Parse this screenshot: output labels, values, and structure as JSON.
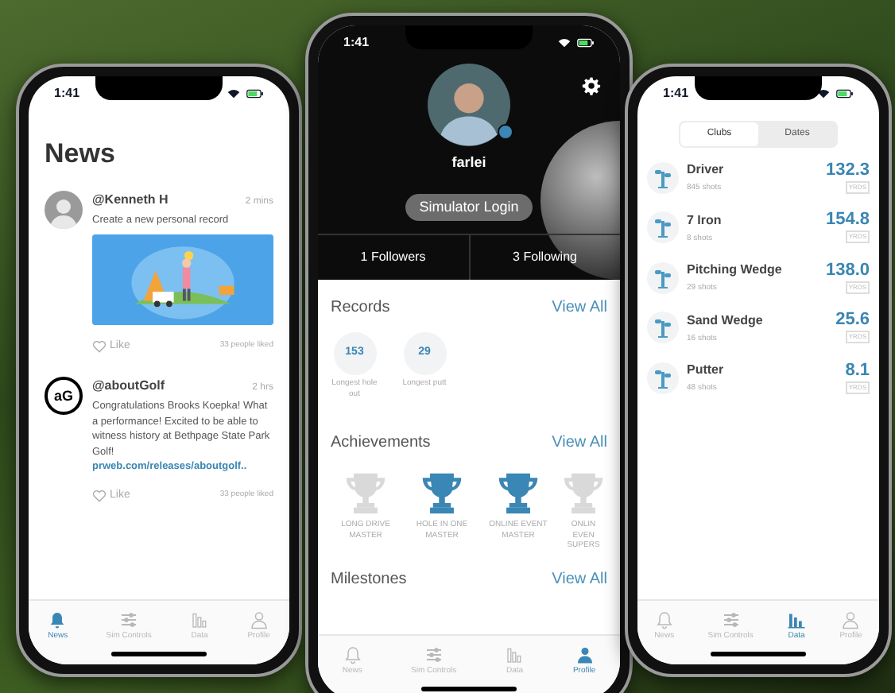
{
  "news_phone": {
    "time": "1:41",
    "title": "News",
    "posts": [
      {
        "kind": "photo",
        "author": "@Kenneth H",
        "age": "2 mins",
        "text": "Create a new personal record",
        "image": true,
        "like": "Like",
        "likes": "33 people liked"
      },
      {
        "kind": "logo",
        "logo": "aG",
        "author": "@aboutGolf",
        "age": "2 hrs",
        "text": "Congratulations Brooks Koepka! What a performance! Excited to be able to witness history at Bethpage State Park Golf!",
        "link": "prweb.com/releases/aboutgolf..",
        "like": "Like",
        "likes": "33 people liked"
      }
    ],
    "tabs": [
      {
        "label": "News",
        "selected": true
      },
      {
        "label": "Sim Controls",
        "selected": false
      },
      {
        "label": "Data",
        "selected": false
      },
      {
        "label": "Profile",
        "selected": false
      }
    ]
  },
  "profile_phone": {
    "time": "1:41",
    "username": "farlei",
    "login_button": "Simulator Login",
    "followers": "1 Followers",
    "following": "3 Following",
    "records": {
      "title": "Records",
      "action": "View All",
      "items": [
        {
          "value": "153",
          "label": "Longest hole out"
        },
        {
          "value": "29",
          "label": "Longest putt"
        }
      ]
    },
    "achievements": {
      "title": "Achievements",
      "action": "View All",
      "items": [
        {
          "label": "LONG DRIVE MASTER",
          "earned": false
        },
        {
          "label": "HOLE IN ONE MASTER",
          "earned": true
        },
        {
          "label": "ONLINE EVENT MASTER",
          "earned": true
        },
        {
          "label": "ONLIN EVEN SUPERS",
          "earned": false
        }
      ]
    },
    "milestones": {
      "title": "Milestones",
      "action": "View All"
    },
    "tabs": [
      {
        "label": "News",
        "selected": false
      },
      {
        "label": "Sim Controls",
        "selected": false
      },
      {
        "label": "Data",
        "selected": false
      },
      {
        "label": "Profile",
        "selected": true
      }
    ]
  },
  "data_phone": {
    "time": "1:41",
    "segments": [
      {
        "label": "Clubs",
        "selected": true
      },
      {
        "label": "Dates",
        "selected": false
      }
    ],
    "clubs": [
      {
        "name": "Driver",
        "shots": "845 shots",
        "distance": "132.3",
        "unit": "YRDS"
      },
      {
        "name": "7 Iron",
        "shots": "8 shots",
        "distance": "154.8",
        "unit": "YRDS"
      },
      {
        "name": "Pitching Wedge",
        "shots": "29 shots",
        "distance": "138.0",
        "unit": "YRDS"
      },
      {
        "name": "Sand Wedge",
        "shots": "16 shots",
        "distance": "25.6",
        "unit": "YRDS"
      },
      {
        "name": "Putter",
        "shots": "48 shots",
        "distance": "8.1",
        "unit": "YRDS"
      }
    ],
    "tabs": [
      {
        "label": "News",
        "selected": false
      },
      {
        "label": "Sim Controls",
        "selected": false
      },
      {
        "label": "Data",
        "selected": true
      },
      {
        "label": "Profile",
        "selected": false
      }
    ]
  }
}
